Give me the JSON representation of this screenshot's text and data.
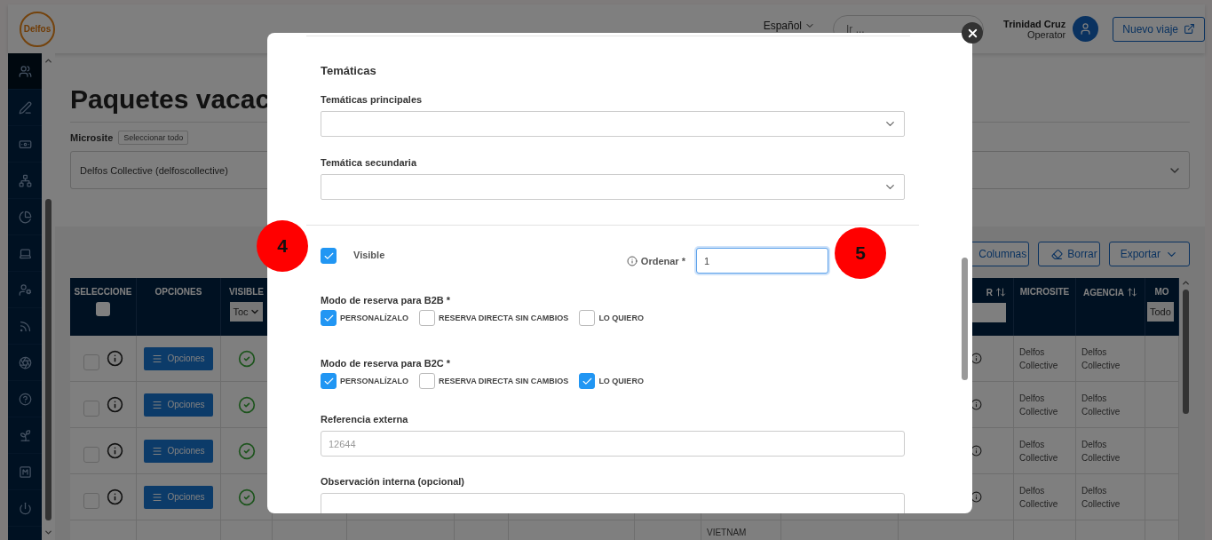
{
  "header": {
    "logo": "Delfos",
    "language": "Español",
    "search": {
      "placeholder": "Ir ..."
    },
    "user": {
      "name": "Trinidad Cruz",
      "role": "Operator"
    },
    "new_trip_button": "Nuevo viaje"
  },
  "sidebar": {
    "items": [
      {
        "selected": true
      },
      {
        "selected": false
      },
      {
        "selected": false
      },
      {
        "selected": false
      },
      {
        "selected": false
      },
      {
        "selected": false
      },
      {
        "selected": false
      },
      {
        "selected": false
      },
      {
        "selected": false
      },
      {
        "selected": false
      },
      {
        "selected": false
      },
      {
        "selected": false
      },
      {
        "selected": false
      }
    ]
  },
  "page": {
    "title": "Paquetes vacac",
    "microsite_label": "Microsite",
    "select_all_button": "Seleccionar todo",
    "microsite_select": {
      "value": "Delfos Collective (delfoscollective)"
    }
  },
  "toolbar": {
    "buttons": [
      {
        "label": "Columnas",
        "kind": "plain"
      },
      {
        "label": "Borrar",
        "kind": "eraser"
      },
      {
        "label": "Exportar",
        "kind": "dropdown"
      }
    ]
  },
  "table": {
    "left_columns": [
      {
        "label": "SELECCIONE",
        "kind": "checkbox",
        "checked": false
      },
      {
        "label": "OPCIONES",
        "kind": "plain"
      },
      {
        "label": "VISIBLE",
        "kind": "select",
        "filter": "Toc"
      }
    ],
    "right_columns": [
      {
        "label": "R",
        "kind": "text",
        "sortable": true
      },
      {
        "label": "MICROSITE",
        "kind": "plain",
        "sortable": false
      },
      {
        "label": "AGENCIA",
        "kind": "plain",
        "sortable": true
      },
      {
        "label": "MO",
        "kind": "select",
        "filter": "Todo",
        "sortable": false
      }
    ],
    "rows": [
      {
        "checked": false,
        "visible": true,
        "options_button": "Opciones",
        "microsite": "Delfos Collective",
        "agency": "Delfos Collective"
      },
      {
        "checked": false,
        "visible": true,
        "options_button": "Opciones",
        "microsite": "Delfos Collective",
        "agency": "Delfos Collective"
      },
      {
        "checked": false,
        "visible": true,
        "options_button": "Opciones",
        "microsite": "Delfos Collective",
        "agency": "Delfos Collective"
      },
      {
        "checked": false,
        "visible": true,
        "options_button": "Opciones",
        "microsite": "Delfos Collective",
        "agency": "Delfos Collective"
      }
    ],
    "partial_row": {
      "column_9": "VIETNAM"
    }
  },
  "modal": {
    "heading": "Temáticas",
    "main_themes": {
      "label": "Temáticas principales"
    },
    "secondary_theme": {
      "label": "Temática secundaria"
    },
    "visible": {
      "label": "Visible",
      "checked": true
    },
    "order": {
      "label": "Ordenar *",
      "value": "1",
      "focused": true
    },
    "booking_modes": [
      {
        "label": "Modo de reserva para B2B *",
        "options": [
          {
            "label": "PERSONALÍZALO",
            "checked": true
          },
          {
            "label": "RESERVA DIRECTA SIN CAMBIOS",
            "checked": false
          },
          {
            "label": "LO QUIERO",
            "checked": false
          }
        ]
      },
      {
        "label": "Modo de reserva para B2C *",
        "options": [
          {
            "label": "PERSONALÍZALO",
            "checked": true
          },
          {
            "label": "RESERVA DIRECTA SIN CAMBIOS",
            "checked": false
          },
          {
            "label": "LO QUIERO",
            "checked": true
          }
        ]
      }
    ],
    "external_reference": {
      "label": "Referencia externa",
      "placeholder": "12644"
    },
    "internal_note": {
      "label": "Observación interna (opcional)"
    }
  },
  "annotations": [
    {
      "label": "4"
    },
    {
      "label": "5"
    }
  ]
}
